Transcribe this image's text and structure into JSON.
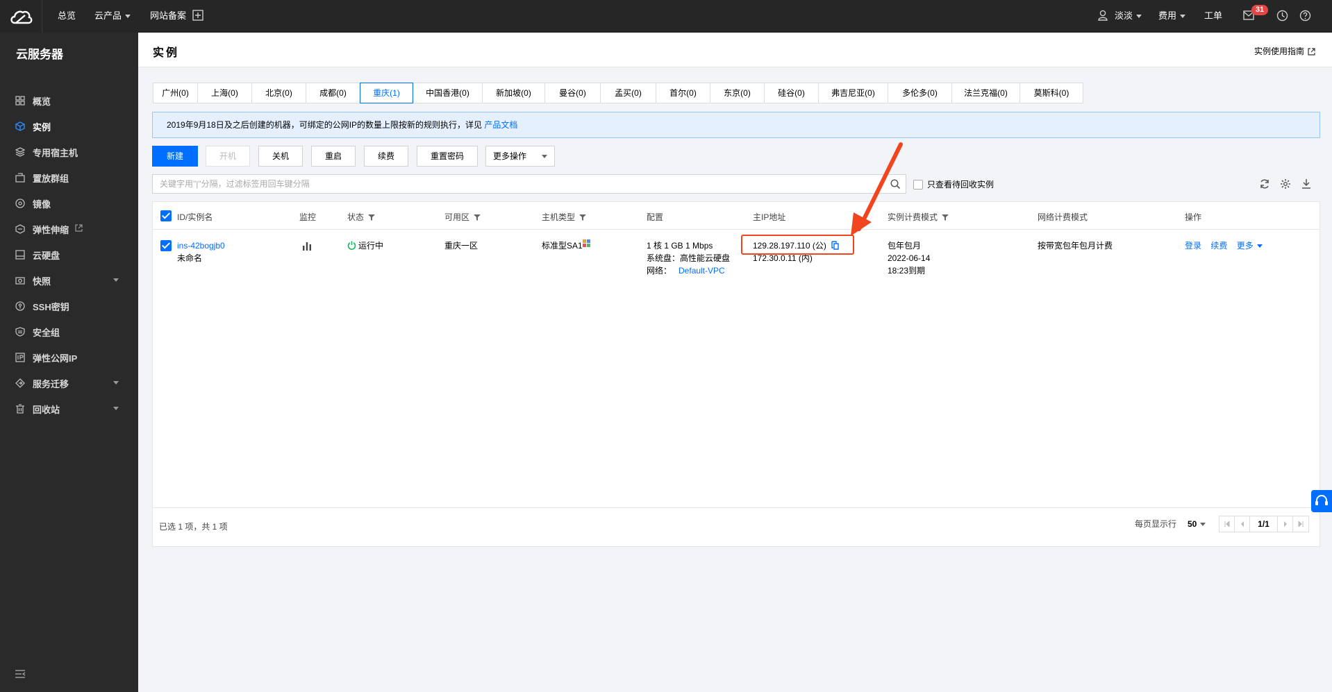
{
  "topbar": {
    "nav": [
      "总览",
      "云产品",
      "网站备案"
    ],
    "user": "淡淡",
    "fees": "费用",
    "ticket": "工单",
    "mail_count": "31"
  },
  "sidebar": {
    "title": "云服务器",
    "items": [
      {
        "label": "概览",
        "icon": "grid-icon"
      },
      {
        "label": "实例",
        "icon": "cube-icon",
        "active": true
      },
      {
        "label": "专用宿主机",
        "icon": "layers-icon"
      },
      {
        "label": "置放群组",
        "icon": "group-icon"
      },
      {
        "label": "镜像",
        "icon": "disc-icon"
      },
      {
        "label": "弹性伸缩",
        "icon": "scale-icon",
        "external": true
      },
      {
        "label": "云硬盘",
        "icon": "disk-icon"
      },
      {
        "label": "快照",
        "icon": "camera-icon",
        "expandable": true
      },
      {
        "label": "SSH密钥",
        "icon": "key-icon"
      },
      {
        "label": "安全组",
        "icon": "shield-icon"
      },
      {
        "label": "弹性公网IP",
        "icon": "ip-icon"
      },
      {
        "label": "服务迁移",
        "icon": "migrate-icon",
        "expandable": true
      },
      {
        "label": "回收站",
        "icon": "trash-icon",
        "expandable": true
      }
    ]
  },
  "header": {
    "title": "实例",
    "guide": "实例使用指南"
  },
  "regions": [
    "广州(0)",
    "上海(0)",
    "北京(0)",
    "成都(0)",
    "重庆(1)",
    "中国香港(0)",
    "新加坡(0)",
    "曼谷(0)",
    "孟买(0)",
    "首尔(0)",
    "东京(0)",
    "硅谷(0)",
    "弗吉尼亚(0)",
    "多伦多(0)",
    "法兰克福(0)",
    "莫斯科(0)"
  ],
  "active_region": 4,
  "notice": {
    "text": "2019年9月18日及之后创建的机器，可绑定的公网IP的数量上限按新的规则执行，详见 ",
    "link": "产品文档"
  },
  "toolbar": {
    "new": "新建",
    "start": "开机",
    "stop": "关机",
    "restart": "重启",
    "renew": "续费",
    "reset_pwd": "重置密码",
    "more": "更多操作"
  },
  "search": {
    "placeholder": "关键字用\"|\"分隔，过滤标签用回车键分隔",
    "recycle_label": "只查看待回收实例"
  },
  "table": {
    "headers": {
      "id": "ID/实例名",
      "monitor": "监控",
      "status": "状态",
      "zone": "可用区",
      "type": "主机类型",
      "config": "配置",
      "ip": "主IP地址",
      "billing": "实例计费模式",
      "net_billing": "网络计费模式",
      "ops": "操作"
    },
    "row": {
      "id": "ins-42bogjb0",
      "name": "未命名",
      "status": "运行中",
      "zone": "重庆一区",
      "type": "标准型SA1",
      "config_line1": "1 核 1 GB 1 Mbps",
      "config_line2": "系统盘：高性能云硬盘",
      "config_line3_label": "网络：",
      "config_line3_link": "Default-VPC",
      "public_ip": "129.28.197.110 (公)",
      "private_ip": "172.30.0.11 (内)",
      "billing_mode": "包年包月",
      "expire_date": "2022-06-14",
      "expire_time": "18:23到期",
      "net_billing": "按带宽包年包月计费",
      "op_login": "登录",
      "op_renew": "续费",
      "op_more": "更多"
    },
    "footer": {
      "summary": "已选 1 项，共 1 项",
      "page_size_label": "每页显示行",
      "page_size": "50",
      "page": "1/1"
    }
  },
  "colors": {
    "accent": "#006eff",
    "highlight": "#f0451e",
    "running": "#0abf5b"
  }
}
